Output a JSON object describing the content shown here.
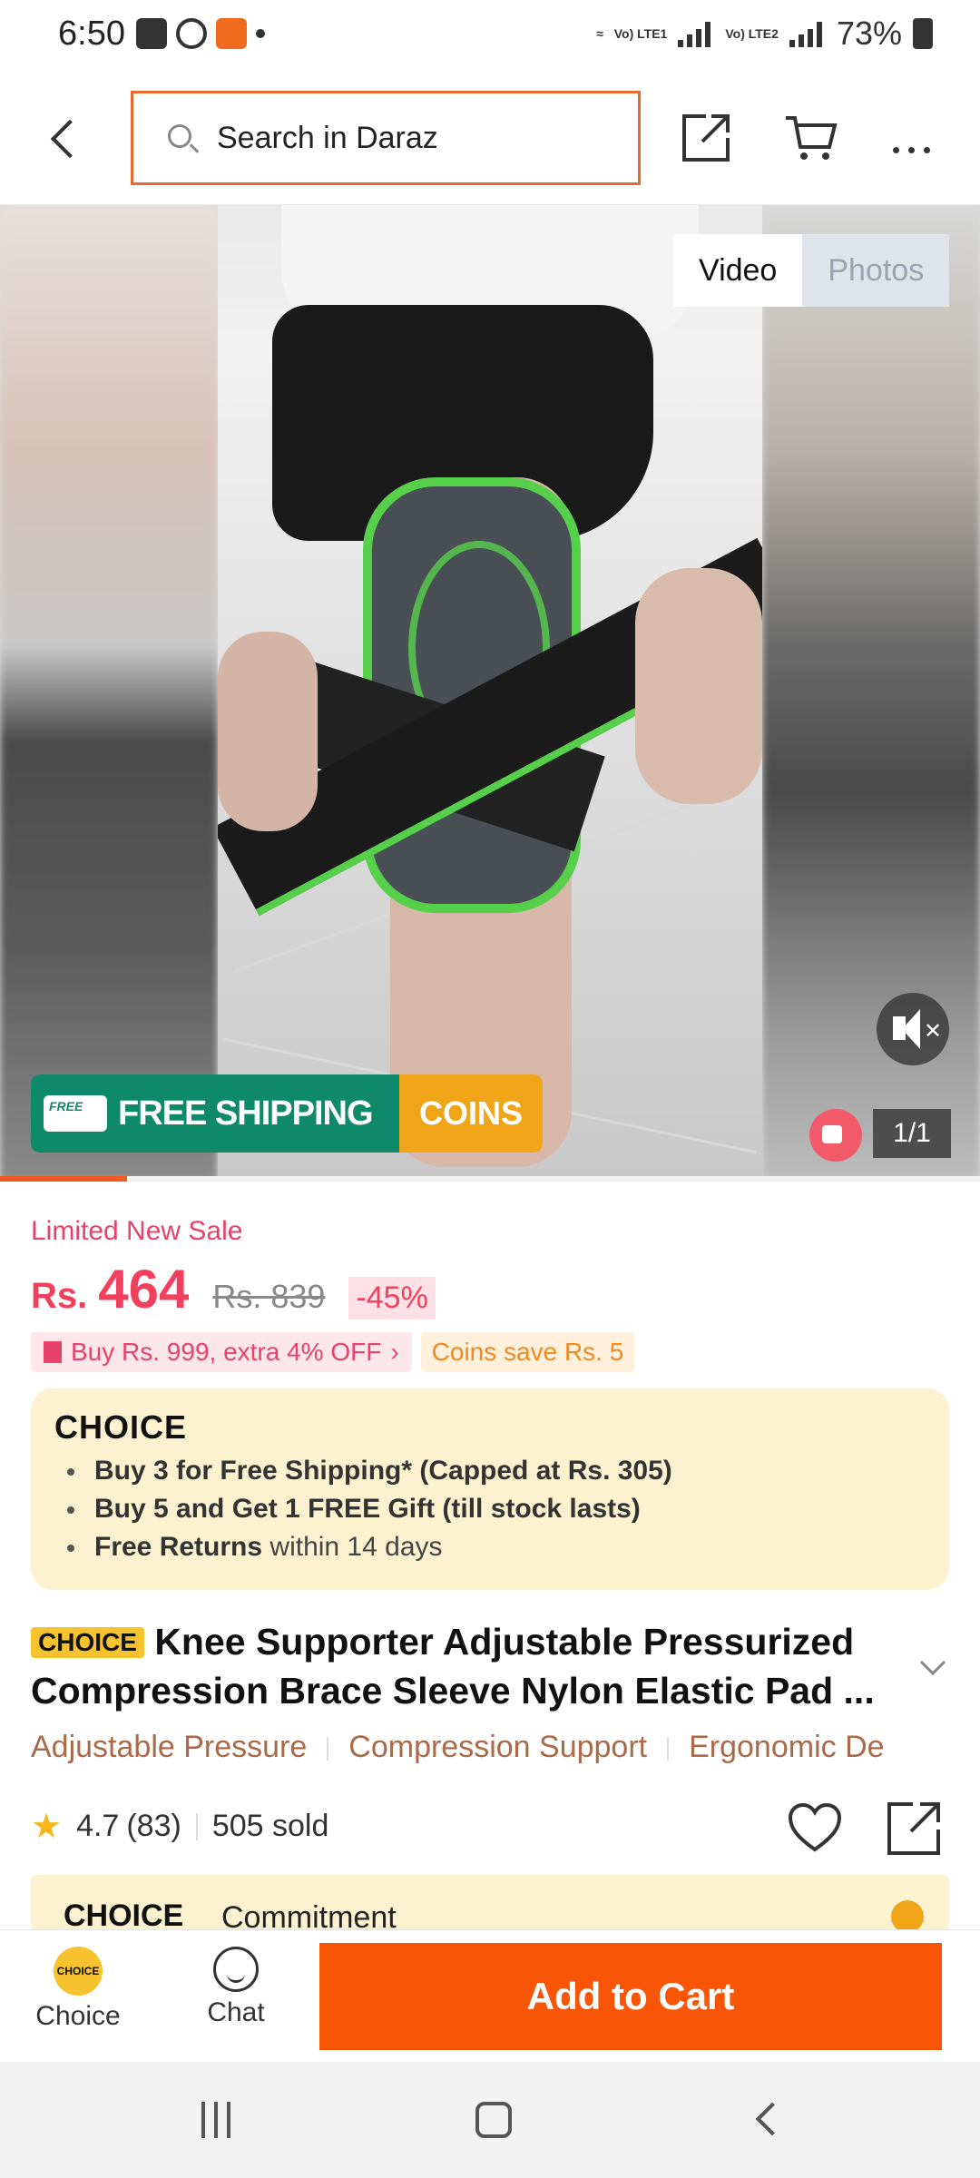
{
  "status_bar": {
    "time": "6:50",
    "battery": "73%",
    "sim1": "Vo) LTE1",
    "sim2": "Vo) LTE2"
  },
  "header": {
    "search_placeholder": "Search in Daraz",
    "icons": [
      "back-arrow-icon",
      "search-icon",
      "share-icon",
      "cart-icon",
      "more-icon"
    ]
  },
  "media": {
    "tab_video": "Video",
    "tab_photos": "Photos",
    "banner_free": "FREE",
    "banner_shipping": "FREE SHIPPING",
    "banner_coins": "COINS",
    "counter": "1/1",
    "progress_fraction": 0.13
  },
  "product": {
    "sale_label": "Limited New Sale",
    "currency": "Rs.",
    "price": "464",
    "original_price": "Rs. 839",
    "discount": "-45%",
    "promo_tag": "Buy Rs. 999, extra 4% OFF",
    "coins_tag": "Coins save Rs. 5",
    "choice_logo": "CHOICE",
    "choice_benefits": [
      {
        "bold": "Buy 3 for  Free Shipping* (Capped at Rs. 305)",
        "rest": ""
      },
      {
        "bold": "Buy 5 and Get 1 FREE Gift (till stock lasts)",
        "rest": ""
      },
      {
        "bold": "Free Returns",
        "rest": " within 14 days"
      }
    ],
    "title_badge": "CHOICE",
    "title": "Knee Supporter Adjustable Pressurized Compression Brace Sleeve Nylon Elastic Pad ...",
    "features": [
      "Adjustable Pressure",
      "Compression Support",
      "Ergonomic De"
    ],
    "rating": "4.7",
    "reviews": "(83)",
    "sold": "505 sold",
    "commitment_logo": "CHOICE",
    "commitment_label": "Commitment"
  },
  "bottom_bar": {
    "choice_icon_text": "CHOICE",
    "choice_label": "Choice",
    "chat_label": "Chat",
    "add_to_cart": "Add to Cart"
  },
  "colors": {
    "accent": "#f85606",
    "price": "#f0405e",
    "choice_bg": "#fdf2cf",
    "free_shipping": "#0e8a6a",
    "coins": "#f0a418"
  }
}
